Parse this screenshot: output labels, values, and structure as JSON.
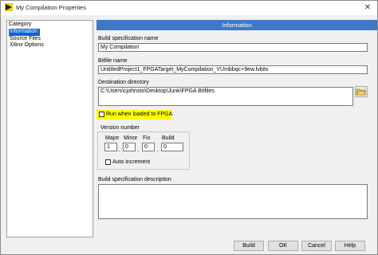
{
  "window": {
    "title": "My Compilation Properties",
    "close_glyph": "✕"
  },
  "category": {
    "header": "Category",
    "items": [
      {
        "label": "Information",
        "selected": true
      },
      {
        "label": "Source Files",
        "selected": false
      },
      {
        "label": "Xilinx Options",
        "selected": false
      }
    ]
  },
  "panel": {
    "header": "Information",
    "build_spec_name": {
      "label": "Build specification name",
      "value": "My Compilation"
    },
    "bitfile_name": {
      "label": "Bitfile name",
      "value": "UntitledProject1_FPGATarget_MyCompilation_YUmbbqc+9ew.lvbitx"
    },
    "destination": {
      "label": "Destination directory",
      "value": "C:\\Users\\cjohnsto\\Desktop\\Junk\\FPGA Bitfiles",
      "browse_icon": "folder-open-icon"
    },
    "run_when_loaded": {
      "label": "Run when loaded to FPGA",
      "checked": false
    },
    "version": {
      "label": "Version number",
      "major": {
        "label": "Major",
        "value": "1"
      },
      "minor": {
        "label": "Minor",
        "value": "0"
      },
      "fix": {
        "label": "Fix",
        "value": "0"
      },
      "build": {
        "label": "Build",
        "value": "0"
      },
      "separator": ".",
      "auto_increment": {
        "label": "Auto increment",
        "checked": false
      }
    },
    "description": {
      "label": "Build specification description",
      "value": ""
    }
  },
  "buttons": {
    "build": "Build",
    "ok": "OK",
    "cancel": "Cancel",
    "help": "Help"
  },
  "colors": {
    "panel_header": "#3e78c7",
    "selection": "#0a64d8",
    "highlight": "#ffff00"
  }
}
